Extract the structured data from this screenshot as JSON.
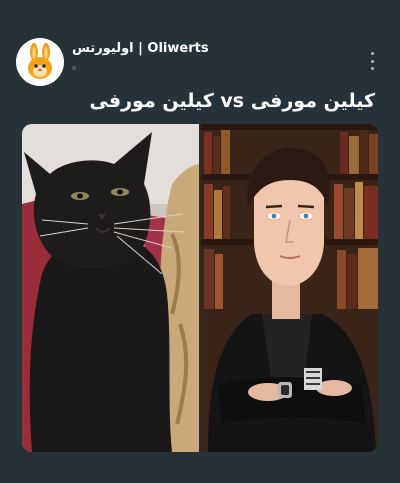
{
  "post": {
    "author_name": "اولیورتس | Oliwerts",
    "caption": "کیلین مورفی vs کیلین مورفی"
  },
  "icons": {
    "avatar": "rabbit-avatar-icon",
    "menu": "more-vertical-icon"
  },
  "colors": {
    "background": "#263238",
    "avatar_accent": "#f4a21a",
    "text": "#ffffff"
  }
}
